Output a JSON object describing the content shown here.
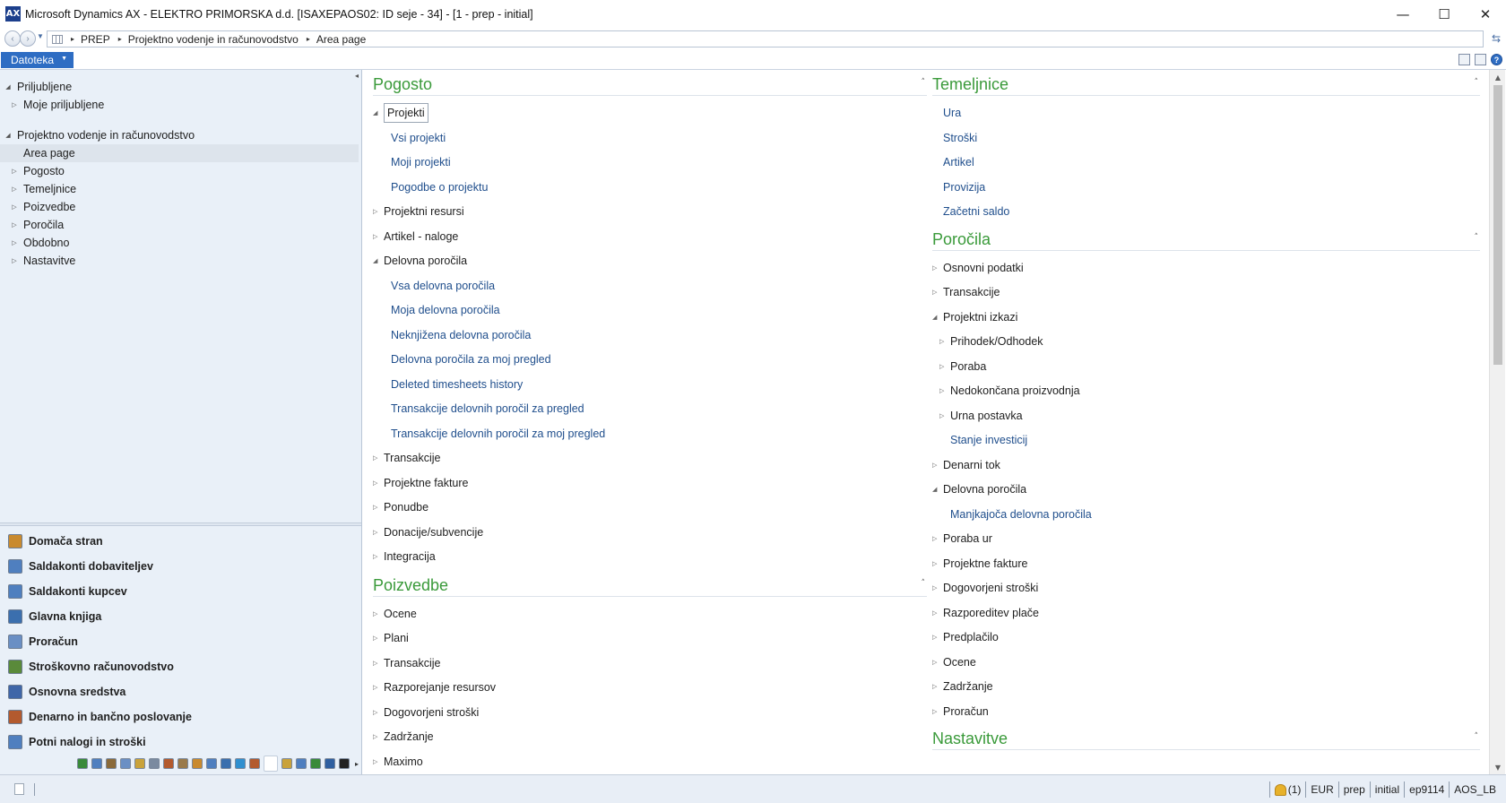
{
  "window": {
    "logo_text": "AX",
    "title": "Microsoft Dynamics AX - ELEKTRO PRIMORSKA d.d. [ISAXEPAOS02: ID seje - 34] -  [1 - prep - initial]",
    "minimize_glyph": "—",
    "maximize_glyph": "☐",
    "close_glyph": "✕"
  },
  "address": {
    "back_glyph": "‹",
    "forward_glyph": "›",
    "drop_glyph": "▼",
    "separator_glyph": "▸",
    "crumbs": [
      "PREP",
      "Projektno vodenje in računovodstvo",
      "Area page"
    ],
    "refresh_glyph": "⇆"
  },
  "menu": {
    "file_label": "Datoteka",
    "caret_glyph": "▼",
    "help_glyph": "?"
  },
  "navpane": {
    "collapse_glyph": "◂",
    "expanded_glyph": "◢",
    "collapsed_glyph": "▷",
    "favorites": {
      "label": "Priljubljene",
      "children": [
        "Moje priljubljene"
      ]
    },
    "module": {
      "label": "Projektno vodenje in računovodstvo",
      "children": [
        "Area page",
        "Pogosto",
        "Temeljnice",
        "Poizvedbe",
        "Poročila",
        "Obdobno",
        "Nastavitve"
      ]
    },
    "modules": [
      {
        "label": "Domača stran",
        "color": "#c98a2e"
      },
      {
        "label": "Saldakonti dobaviteljev",
        "color": "#4f7fbf"
      },
      {
        "label": "Saldakonti kupcev",
        "color": "#4f7fbf"
      },
      {
        "label": "Glavna knjiga",
        "color": "#3b6fae"
      },
      {
        "label": "Proračun",
        "color": "#6a8fc4"
      },
      {
        "label": "Stroškovno računovodstvo",
        "color": "#5a8a3a"
      },
      {
        "label": "Osnovna sredstva",
        "color": "#3f66a8"
      },
      {
        "label": "Denarno in bančno poslovanje",
        "color": "#b35a2e"
      },
      {
        "label": "Potni nalogi in stroški",
        "color": "#4f7fbf"
      }
    ],
    "mini_icon_colors": [
      "#3a8a3a",
      "#4f7fbf",
      "#8a6a3a",
      "#6a8fc4",
      "#c9a23a",
      "#7a8aa0",
      "#b35a2e",
      "#9a7a4a",
      "#c98a2e",
      "#4f7fbf",
      "#3a6fae",
      "#2f8fcf",
      "#b35a2e"
    ],
    "mini_icon_colors_after": [
      "#c9a23a",
      "#4f7fbf",
      "#3a8a3a",
      "#2f5fa0",
      "#222222"
    ],
    "mini_more_glyph": "▸"
  },
  "content": {
    "collapse_chevron": "˄",
    "left_groups": [
      {
        "title": "Pogosto",
        "items": [
          {
            "label": "Projekti",
            "kind": "folder",
            "state": "expanded",
            "level": 0,
            "focused": true
          },
          {
            "label": "Vsi projekti",
            "kind": "link",
            "level": 1
          },
          {
            "label": "Moji projekti",
            "kind": "link",
            "level": 1
          },
          {
            "label": "Pogodbe o projektu",
            "kind": "link",
            "level": 1
          },
          {
            "label": "Projektni resursi",
            "kind": "folder",
            "state": "collapsed",
            "level": 0
          },
          {
            "label": "Artikel - naloge",
            "kind": "folder",
            "state": "collapsed",
            "level": 0
          },
          {
            "label": "Delovna poročila",
            "kind": "folder",
            "state": "expanded",
            "level": 0
          },
          {
            "label": "Vsa delovna poročila",
            "kind": "link",
            "level": 1
          },
          {
            "label": "Moja delovna poročila",
            "kind": "link",
            "level": 1
          },
          {
            "label": "Neknjižena delovna poročila",
            "kind": "link",
            "level": 1
          },
          {
            "label": "Delovna poročila za moj pregled",
            "kind": "link",
            "level": 1
          },
          {
            "label": "Deleted timesheets history",
            "kind": "link",
            "level": 1
          },
          {
            "label": "Transakcije delovnih poročil za pregled",
            "kind": "link",
            "level": 1
          },
          {
            "label": "Transakcije delovnih poročil za moj pregled",
            "kind": "link",
            "level": 1
          },
          {
            "label": "Transakcije",
            "kind": "folder",
            "state": "collapsed",
            "level": 0
          },
          {
            "label": "Projektne fakture",
            "kind": "folder",
            "state": "collapsed",
            "level": 0
          },
          {
            "label": "Ponudbe",
            "kind": "folder",
            "state": "collapsed",
            "level": 0
          },
          {
            "label": "Donacije/subvencije",
            "kind": "folder",
            "state": "collapsed",
            "level": 0
          },
          {
            "label": "Integracija",
            "kind": "folder",
            "state": "collapsed",
            "level": 0
          }
        ]
      },
      {
        "title": "Poizvedbe",
        "items": [
          {
            "label": "Ocene",
            "kind": "folder",
            "state": "collapsed",
            "level": 0
          },
          {
            "label": "Plani",
            "kind": "folder",
            "state": "collapsed",
            "level": 0
          },
          {
            "label": "Transakcije",
            "kind": "folder",
            "state": "collapsed",
            "level": 0
          },
          {
            "label": "Razporejanje resursov",
            "kind": "folder",
            "state": "collapsed",
            "level": 0
          },
          {
            "label": "Dogovorjeni stroški",
            "kind": "folder",
            "state": "collapsed",
            "level": 0
          },
          {
            "label": "Zadržanje",
            "kind": "folder",
            "state": "collapsed",
            "level": 0
          },
          {
            "label": "Maximo",
            "kind": "folder",
            "state": "collapsed",
            "level": 0
          }
        ]
      }
    ],
    "right_groups": [
      {
        "title": "Temeljnice",
        "items": [
          {
            "label": "Ura",
            "kind": "link",
            "level": 0
          },
          {
            "label": "Stroški",
            "kind": "link",
            "level": 0
          },
          {
            "label": "Artikel",
            "kind": "link",
            "level": 0
          },
          {
            "label": "Provizija",
            "kind": "link",
            "level": 0
          },
          {
            "label": "Začetni saldo",
            "kind": "link",
            "level": 0
          }
        ]
      },
      {
        "title": "Poročila",
        "items": [
          {
            "label": "Osnovni podatki",
            "kind": "folder",
            "state": "collapsed",
            "level": 0
          },
          {
            "label": "Transakcije",
            "kind": "folder",
            "state": "collapsed",
            "level": 0
          },
          {
            "label": "Projektni izkazi",
            "kind": "folder",
            "state": "expanded",
            "level": 0
          },
          {
            "label": "Prihodek/Odhodek",
            "kind": "folder",
            "state": "collapsed",
            "level": 1
          },
          {
            "label": "Poraba",
            "kind": "folder",
            "state": "collapsed",
            "level": 1
          },
          {
            "label": "Nedokončana proizvodnja",
            "kind": "folder",
            "state": "collapsed",
            "level": 1
          },
          {
            "label": "Urna postavka",
            "kind": "folder",
            "state": "collapsed",
            "level": 1
          },
          {
            "label": "Stanje investicij",
            "kind": "link",
            "level": 1
          },
          {
            "label": "Denarni tok",
            "kind": "folder",
            "state": "collapsed",
            "level": 0
          },
          {
            "label": "Delovna poročila",
            "kind": "folder",
            "state": "expanded",
            "level": 0
          },
          {
            "label": "Manjkajoča delovna poročila",
            "kind": "link",
            "level": 1
          },
          {
            "label": "Poraba ur",
            "kind": "folder",
            "state": "collapsed",
            "level": 0
          },
          {
            "label": "Projektne fakture",
            "kind": "folder",
            "state": "collapsed",
            "level": 0
          },
          {
            "label": "Dogovorjeni stroški",
            "kind": "folder",
            "state": "collapsed",
            "level": 0
          },
          {
            "label": "Razporeditev plače",
            "kind": "folder",
            "state": "collapsed",
            "level": 0
          },
          {
            "label": "Predplačilo",
            "kind": "folder",
            "state": "collapsed",
            "level": 0
          },
          {
            "label": "Ocene",
            "kind": "folder",
            "state": "collapsed",
            "level": 0
          },
          {
            "label": "Zadržanje",
            "kind": "folder",
            "state": "collapsed",
            "level": 0
          },
          {
            "label": "Proračun",
            "kind": "folder",
            "state": "collapsed",
            "level": 0
          }
        ]
      },
      {
        "title": "Nastavitve",
        "items": []
      }
    ]
  },
  "scrollbar": {
    "up_glyph": "▲",
    "down_glyph": "▼"
  },
  "status": {
    "notifications": "(1)",
    "currency": "EUR",
    "company": "prep",
    "layer": "initial",
    "user": "ep9114",
    "server": "AOS_LB"
  }
}
